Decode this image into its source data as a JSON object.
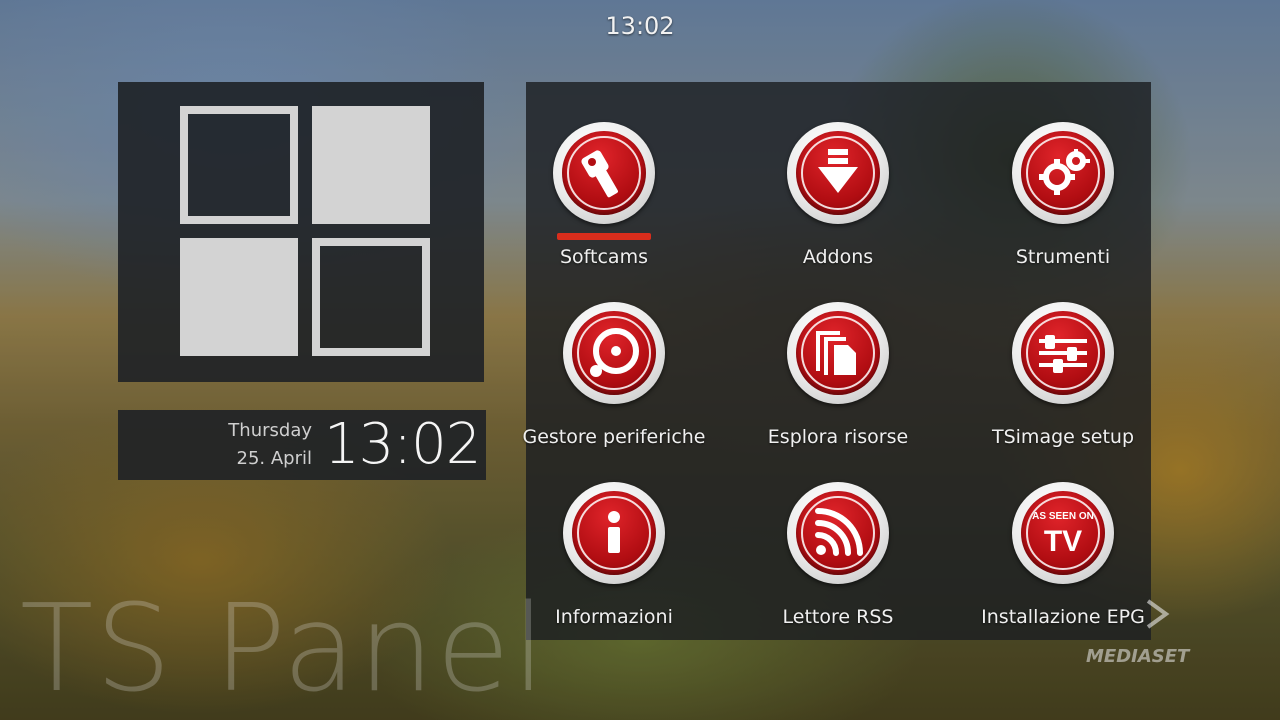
{
  "clock": {
    "top_time": "13:02",
    "day": "Thursday",
    "date": "25. April",
    "big_time": "13:02"
  },
  "watermark": "TS Panel",
  "channel_logo": "MEDIASET",
  "accent_color": "#d92d1c",
  "menu": {
    "selected_index": 0,
    "items": [
      {
        "label": "Softcams",
        "icon": "softcam-key-icon"
      },
      {
        "label": "Addons",
        "icon": "download-arrow-icon"
      },
      {
        "label": "Strumenti",
        "icon": "gears-icon"
      },
      {
        "label": "Gestore periferiche",
        "icon": "hard-drive-icon"
      },
      {
        "label": "Esplora risorse",
        "icon": "files-icon"
      },
      {
        "label": "TSimage setup",
        "icon": "sliders-icon"
      },
      {
        "label": "Informazioni",
        "icon": "info-icon"
      },
      {
        "label": "Lettore RSS",
        "icon": "rss-icon"
      },
      {
        "label": "Installazione EPG",
        "icon": "as-seen-on-tv-icon",
        "icon_text_top": "AS SEEN ON",
        "icon_text_main": "TV"
      }
    ]
  }
}
